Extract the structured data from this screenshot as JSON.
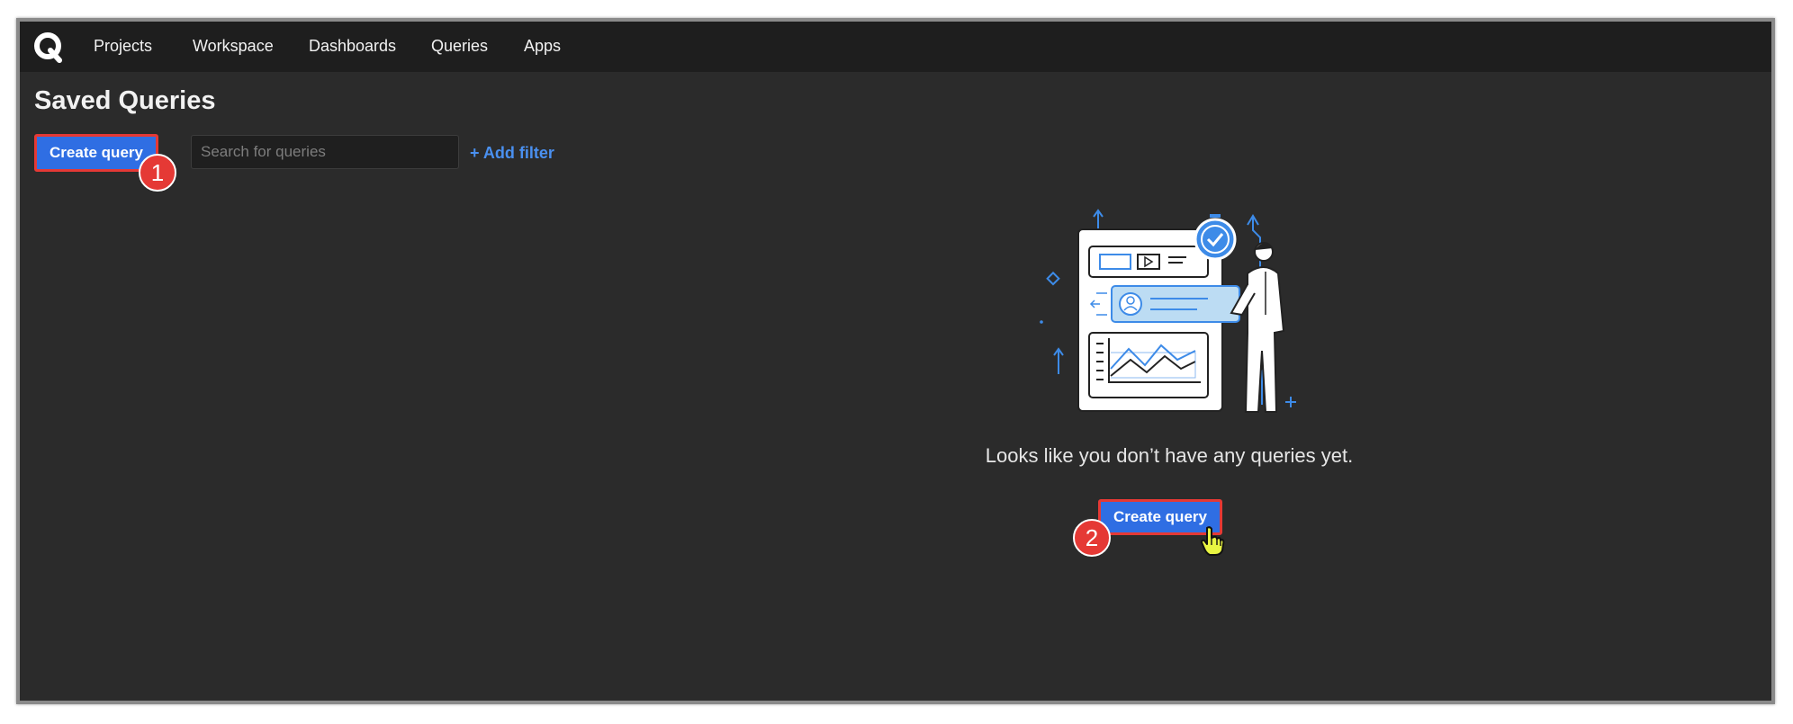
{
  "nav": {
    "logo_icon": "q-logo-icon",
    "items": [
      {
        "label": "Projects"
      },
      {
        "label": "Workspace"
      },
      {
        "label": "Dashboards"
      },
      {
        "label": "Queries"
      },
      {
        "label": "Apps"
      }
    ]
  },
  "page": {
    "title": "Saved Queries"
  },
  "toolbar": {
    "create_label": "Create query",
    "search_placeholder": "Search for queries",
    "add_filter_label": "+ Add filter"
  },
  "empty_state": {
    "message": "Looks like you don’t have any queries yet.",
    "create_label": "Create query",
    "illustration_icon": "person-with-dashboard-illustration"
  },
  "annotations": {
    "step_1": "1",
    "step_2": "2",
    "cursor_icon": "hand-pointer-cursor-icon"
  },
  "colors": {
    "accent": "#2f6ee3",
    "highlight_border": "#e53935",
    "link": "#4a90f0",
    "background": "#2b2b2b",
    "topbar": "#1e1e1e"
  }
}
